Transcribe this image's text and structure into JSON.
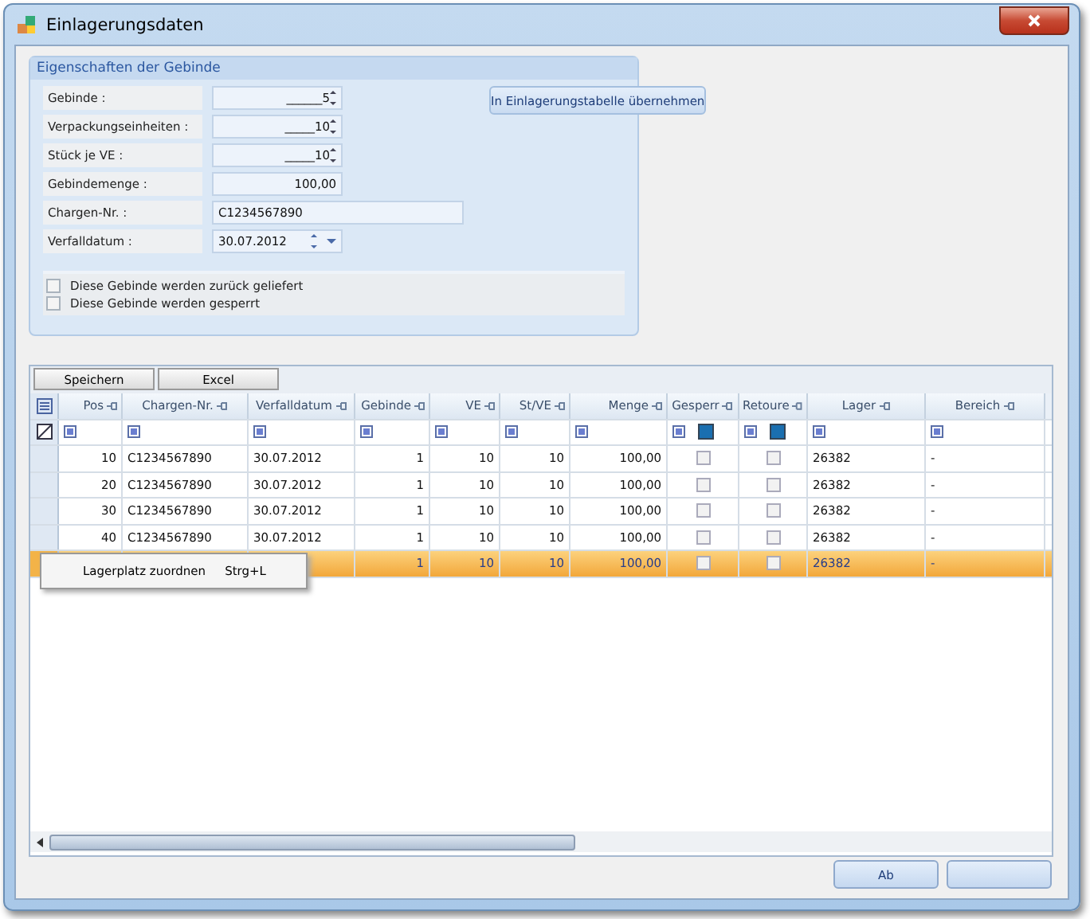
{
  "window": {
    "title": "Einlagerungsdaten"
  },
  "group": {
    "title": "Eigenschaften der Gebinde",
    "fields": [
      {
        "label": "Gebinde :",
        "value": "______5",
        "kind": "spin"
      },
      {
        "label": "Verpackungseinheiten :",
        "value": "_____10",
        "kind": "spin"
      },
      {
        "label": "Stück je VE :",
        "value": "_____10",
        "kind": "spin"
      },
      {
        "label": "Gebindemenge :",
        "value": "100,00",
        "kind": "number"
      },
      {
        "label": "Chargen-Nr. :",
        "value": "C1234567890",
        "kind": "text"
      },
      {
        "label": "Verfalldatum :",
        "value": "30.07.2012",
        "kind": "date"
      }
    ],
    "apply_button": "In Einlagerungstabelle übernehmen",
    "checkboxes": [
      {
        "label": "Diese Gebinde werden zurück geliefert",
        "checked": false
      },
      {
        "label": "Diese Gebinde werden gesperrt",
        "checked": false
      }
    ]
  },
  "grid": {
    "toolbar": [
      "Speichern",
      "Excel"
    ],
    "columns": [
      {
        "label": "Pos",
        "kind": "number"
      },
      {
        "label": "Chargen-Nr.",
        "kind": "text"
      },
      {
        "label": "Verfalldatum",
        "kind": "text"
      },
      {
        "label": "Gebinde",
        "kind": "number"
      },
      {
        "label": "VE",
        "kind": "number"
      },
      {
        "label": "St/VE",
        "kind": "number"
      },
      {
        "label": "Menge",
        "kind": "number"
      },
      {
        "label": "Gesperr",
        "kind": "check"
      },
      {
        "label": "Retoure",
        "kind": "check"
      },
      {
        "label": "Lager",
        "kind": "text"
      },
      {
        "label": "Bereich",
        "kind": "text"
      }
    ],
    "rows": [
      {
        "selected": false,
        "cells": [
          "10",
          "C1234567890",
          "30.07.2012",
          "1",
          "10",
          "10",
          "100,00",
          {
            "checked": false
          },
          {
            "checked": false
          },
          "26382",
          "-"
        ]
      },
      {
        "selected": false,
        "cells": [
          "20",
          "C1234567890",
          "30.07.2012",
          "1",
          "10",
          "10",
          "100,00",
          {
            "checked": false
          },
          {
            "checked": false
          },
          "26382",
          "-"
        ]
      },
      {
        "selected": false,
        "cells": [
          "30",
          "C1234567890",
          "30.07.2012",
          "1",
          "10",
          "10",
          "100,00",
          {
            "checked": false
          },
          {
            "checked": false
          },
          "26382",
          "-"
        ]
      },
      {
        "selected": false,
        "cells": [
          "40",
          "C1234567890",
          "30.07.2012",
          "1",
          "10",
          "10",
          "100,00",
          {
            "checked": false
          },
          {
            "checked": false
          },
          "26382",
          "-"
        ]
      },
      {
        "selected": true,
        "cells": [
          null,
          null,
          null,
          "1",
          "10",
          "10",
          "100,00",
          {
            "checked": false
          },
          {
            "checked": false
          },
          "26382",
          "-"
        ]
      }
    ],
    "context_menu": {
      "label": "Lagerplatz zuordnen",
      "shortcut": "Strg+L"
    }
  },
  "buttons": [
    {
      "kind": "text",
      "label": "Ab"
    },
    {
      "kind": "blank"
    }
  ]
}
